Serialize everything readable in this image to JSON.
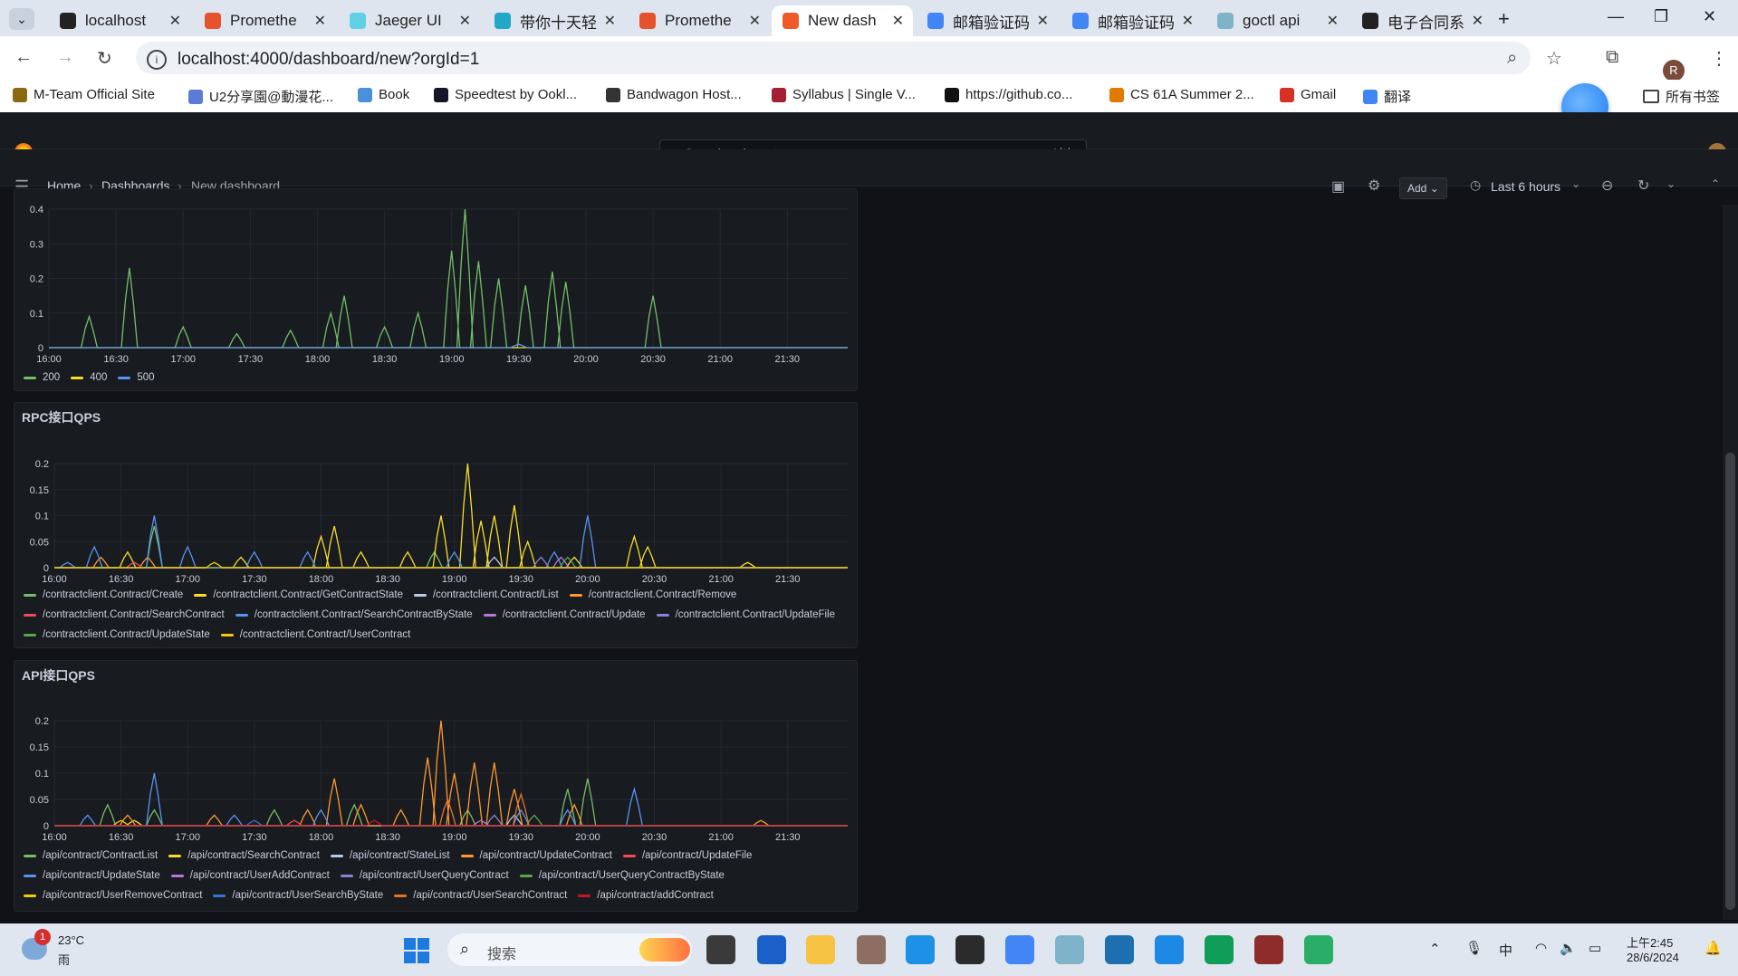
{
  "tabs": [
    {
      "title": "localhost",
      "icon": "grafana-icon",
      "color": "#222222"
    },
    {
      "title": "Promethe",
      "icon": "prometheus-icon",
      "color": "#e6522c"
    },
    {
      "title": "Jaeger UI",
      "icon": "jaeger-icon",
      "color": "#60d0e4"
    },
    {
      "title": "带你十天轻",
      "icon": "doc-icon",
      "color": "#22a7c9"
    },
    {
      "title": "Promethe",
      "icon": "prometheus-icon",
      "color": "#e6522c"
    },
    {
      "title": "New dash",
      "icon": "grafana-icon",
      "color": "#f05a28",
      "active": true
    },
    {
      "title": "邮箱验证码",
      "icon": "chrome-icon",
      "color": "#4285f4"
    },
    {
      "title": "邮箱验证码",
      "icon": "chrome-icon",
      "color": "#4285f4"
    },
    {
      "title": "goctl api",
      "icon": "gopher-icon",
      "color": "#7fb3c9"
    },
    {
      "title": "电子合同系",
      "icon": "react-icon",
      "color": "#222222"
    }
  ],
  "browser": {
    "url": "localhost:4000/dashboard/new?orgId=1",
    "profile_initial": "R"
  },
  "bookmarks": [
    {
      "label": "M-Team Official Site",
      "color": "#8a6a10"
    },
    {
      "label": "U2分享園@動漫花...",
      "color": "#5b7bd5"
    },
    {
      "label": "Book",
      "color": "#4a90d9"
    },
    {
      "label": "Speedtest by Ookl...",
      "color": "#141526"
    },
    {
      "label": "Bandwagon Host...",
      "color": "#333333"
    },
    {
      "label": "Syllabus | Single V...",
      "color": "#a31f34"
    },
    {
      "label": "https://github.co...",
      "color": "#111111"
    },
    {
      "label": "CS 61A Summer 2...",
      "color": "#e07b00"
    },
    {
      "label": "Gmail",
      "color": "#d93025"
    },
    {
      "label": "翻译",
      "color": "#4285f4"
    }
  ],
  "bookmarks_all": "所有书签",
  "grafana": {
    "search_placeholder": "Search or jump to...",
    "search_shortcut": "ctrl+k",
    "breadcrumb": [
      "Home",
      "Dashboards",
      "New dashboard"
    ],
    "add_label": "Add",
    "time_range": "Last 6 hours"
  },
  "chart_data": [
    {
      "type": "line",
      "title": "",
      "x": [
        "16:00",
        "16:30",
        "17:00",
        "17:30",
        "18:00",
        "18:30",
        "19:00",
        "19:30",
        "20:00",
        "20:30",
        "21:00",
        "21:30"
      ],
      "ylim": [
        0,
        0.4
      ],
      "yticks": [
        "0",
        "0.1",
        "0.2",
        "0.3",
        "0.4"
      ],
      "series": [
        {
          "name": "200",
          "color": "#73bf69",
          "peaks": [
            [
              16.3,
              0.09
            ],
            [
              16.6,
              0.23
            ],
            [
              17.0,
              0.06
            ],
            [
              17.4,
              0.04
            ],
            [
              17.8,
              0.05
            ],
            [
              18.1,
              0.1
            ],
            [
              18.2,
              0.15
            ],
            [
              18.5,
              0.06
            ],
            [
              18.75,
              0.1
            ],
            [
              19.0,
              0.28
            ],
            [
              19.1,
              0.4
            ],
            [
              19.2,
              0.25
            ],
            [
              19.35,
              0.2
            ],
            [
              19.55,
              0.18
            ],
            [
              19.75,
              0.22
            ],
            [
              19.85,
              0.19
            ],
            [
              20.5,
              0.15
            ]
          ]
        },
        {
          "name": "400",
          "color": "#fade2a",
          "peaks": []
        },
        {
          "name": "500",
          "color": "#5794f2",
          "peaks": [
            [
              19.5,
              0.01
            ]
          ]
        }
      ]
    },
    {
      "type": "line",
      "title": "RPC接口QPS",
      "x": [
        "16:00",
        "16:30",
        "17:00",
        "17:30",
        "18:00",
        "18:30",
        "19:00",
        "19:30",
        "20:00",
        "20:30",
        "21:00",
        "21:30"
      ],
      "ylim": [
        0,
        0.2
      ],
      "yticks": [
        "0",
        "0.05",
        "0.1",
        "0.15",
        "0.2"
      ],
      "series": [
        {
          "name": "/contractclient.Contract/Create",
          "color": "#73bf69",
          "peaks": [
            [
              16.75,
              0.08
            ],
            [
              18.85,
              0.03
            ]
          ]
        },
        {
          "name": "/contractclient.Contract/GetContractState",
          "color": "#fade2a",
          "peaks": [
            [
              16.55,
              0.03
            ],
            [
              17.4,
              0.02
            ],
            [
              18.0,
              0.06
            ],
            [
              18.1,
              0.08
            ],
            [
              18.3,
              0.03
            ],
            [
              18.65,
              0.03
            ],
            [
              18.9,
              0.1
            ],
            [
              19.1,
              0.2
            ],
            [
              19.2,
              0.09
            ],
            [
              19.3,
              0.1
            ],
            [
              19.45,
              0.12
            ],
            [
              19.55,
              0.05
            ],
            [
              19.9,
              0.02
            ],
            [
              20.35,
              0.06
            ],
            [
              20.45,
              0.04
            ],
            [
              21.2,
              0.01
            ]
          ]
        },
        {
          "name": "/contractclient.Contract/List",
          "color": "#b8c8f0",
          "peaks": [
            [
              19.3,
              0.02
            ]
          ]
        },
        {
          "name": "/contractclient.Contract/Remove",
          "color": "#ff9830",
          "peaks": [
            [
              16.35,
              0.02
            ],
            [
              16.7,
              0.02
            ]
          ]
        },
        {
          "name": "/contractclient.Contract/SearchContract",
          "color": "#f2495c",
          "peaks": [
            [
              16.6,
              0.01
            ]
          ]
        },
        {
          "name": "/contractclient.Contract/SearchContractByState",
          "color": "#5794f2",
          "peaks": [
            [
              16.1,
              0.01
            ],
            [
              16.3,
              0.04
            ],
            [
              16.75,
              0.1
            ],
            [
              17.0,
              0.04
            ],
            [
              17.5,
              0.03
            ],
            [
              17.9,
              0.03
            ],
            [
              19.0,
              0.03
            ],
            [
              19.75,
              0.03
            ],
            [
              20.0,
              0.1
            ]
          ]
        },
        {
          "name": "/contractclient.Contract/Update",
          "color": "#b877d9",
          "peaks": [
            [
              19.8,
              0.02
            ]
          ]
        },
        {
          "name": "/contractclient.Contract/UpdateFile",
          "color": "#8f7fd9",
          "peaks": [
            [
              19.65,
              0.02
            ]
          ]
        },
        {
          "name": "/contractclient.Contract/UpdateState",
          "color": "#56a64b",
          "peaks": [
            [
              19.85,
              0.02
            ]
          ]
        },
        {
          "name": "/contractclient.Contract/UserContract",
          "color": "#f2cc0c",
          "peaks": [
            [
              17.2,
              0.01
            ]
          ]
        }
      ]
    },
    {
      "type": "line",
      "title": "API接口QPS",
      "x": [
        "16:00",
        "16:30",
        "17:00",
        "17:30",
        "18:00",
        "18:30",
        "19:00",
        "19:30",
        "20:00",
        "20:30",
        "21:00",
        "21:30"
      ],
      "ylim": [
        0,
        0.2
      ],
      "yticks": [
        "0",
        "0.05",
        "0.1",
        "0.15",
        "0.2"
      ],
      "series": [
        {
          "name": "/api/contract/ContractList",
          "color": "#73bf69",
          "peaks": [
            [
              16.4,
              0.04
            ],
            [
              16.75,
              0.03
            ],
            [
              17.65,
              0.03
            ],
            [
              18.25,
              0.04
            ],
            [
              19.1,
              0.03
            ],
            [
              19.85,
              0.07
            ],
            [
              20.0,
              0.09
            ]
          ]
        },
        {
          "name": "/api/contract/SearchContract",
          "color": "#fade2a",
          "peaks": [
            [
              16.6,
              0.01
            ]
          ]
        },
        {
          "name": "/api/contract/StateList",
          "color": "#b8c8f0",
          "peaks": [
            [
              19.45,
              0.02
            ]
          ]
        },
        {
          "name": "/api/contract/UpdateContract",
          "color": "#ff9830",
          "peaks": [
            [
              16.55,
              0.02
            ],
            [
              17.2,
              0.02
            ],
            [
              17.9,
              0.03
            ],
            [
              18.1,
              0.09
            ],
            [
              18.3,
              0.04
            ],
            [
              18.6,
              0.03
            ],
            [
              18.8,
              0.13
            ],
            [
              18.9,
              0.21
            ],
            [
              19.0,
              0.1
            ],
            [
              19.15,
              0.12
            ],
            [
              19.3,
              0.12
            ],
            [
              19.45,
              0.07
            ],
            [
              19.9,
              0.04
            ],
            [
              21.3,
              0.01
            ]
          ]
        },
        {
          "name": "/api/contract/UpdateFile",
          "color": "#f2495c",
          "peaks": [
            [
              17.8,
              0.01
            ]
          ]
        },
        {
          "name": "/api/contract/UpdateState",
          "color": "#5794f2",
          "peaks": [
            [
              16.25,
              0.02
            ],
            [
              16.75,
              0.1
            ],
            [
              17.35,
              0.02
            ],
            [
              18.0,
              0.03
            ],
            [
              19.5,
              0.03
            ],
            [
              19.85,
              0.03
            ],
            [
              20.35,
              0.07
            ]
          ]
        },
        {
          "name": "/api/contract/UserAddContract",
          "color": "#b877d9",
          "peaks": [
            [
              19.2,
              0.01
            ]
          ]
        },
        {
          "name": "/api/contract/UserQueryContract",
          "color": "#8f7fd9",
          "peaks": [
            [
              19.3,
              0.02
            ]
          ]
        },
        {
          "name": "/api/contract/UserQueryContractByState",
          "color": "#56a64b",
          "peaks": [
            [
              19.6,
              0.02
            ]
          ]
        },
        {
          "name": "/api/contract/UserRemoveContract",
          "color": "#f2cc0c",
          "peaks": [
            [
              16.5,
              0.01
            ]
          ]
        },
        {
          "name": "/api/contract/UserSearchByState",
          "color": "#3274d9",
          "peaks": [
            [
              17.5,
              0.01
            ]
          ]
        },
        {
          "name": "/api/contract/UserSearchContract",
          "color": "#e0752d",
          "peaks": [
            [
              18.95,
              0.05
            ],
            [
              19.5,
              0.06
            ]
          ]
        },
        {
          "name": "/api/contract/addContract",
          "color": "#c4162a",
          "peaks": [
            [
              18.4,
              0.01
            ]
          ]
        }
      ]
    }
  ],
  "taskbar": {
    "weather_temp": "23°C",
    "weather_desc": "雨",
    "weather_badge": "1",
    "search_label": "搜索",
    "ime": "中",
    "time": "上午2:45",
    "date": "28/6/2024"
  }
}
